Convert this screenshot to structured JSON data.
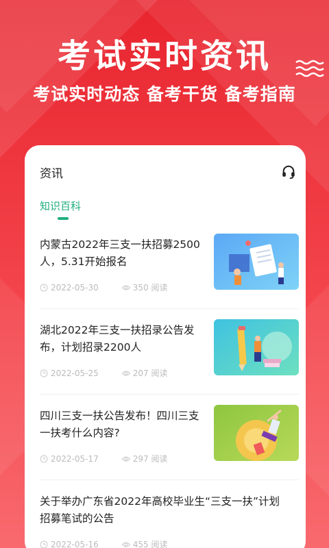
{
  "banner": {
    "headline": "考试实时资讯",
    "subline": "考试实时动态 备考干货 备考指南"
  },
  "card": {
    "title": "资讯",
    "tab": "知识百科"
  },
  "articles": [
    {
      "title": "内蒙古2022年三支一扶招募2500人，5.31开始报名",
      "date": "2022-05-30",
      "views": "350 阅读",
      "thumb": "office-illustration"
    },
    {
      "title": "湖北2022年三支一扶招录公告发布，计划招录2200人",
      "date": "2022-05-25",
      "views": "207 阅读",
      "thumb": "pencil-illustration"
    },
    {
      "title": "四川三支一扶公告发布！四川三支一扶考什么内容?",
      "date": "2022-05-17",
      "views": "297 阅读",
      "thumb": "success-illustration"
    },
    {
      "title": "关于举办广东省2022年高校毕业生“三支一扶”计划招募笔试的公告",
      "date": "2022-05-16",
      "views": "455 阅读"
    }
  ],
  "colors": {
    "brand_red": "#f0333c",
    "accent_green": "#1fae7c"
  }
}
